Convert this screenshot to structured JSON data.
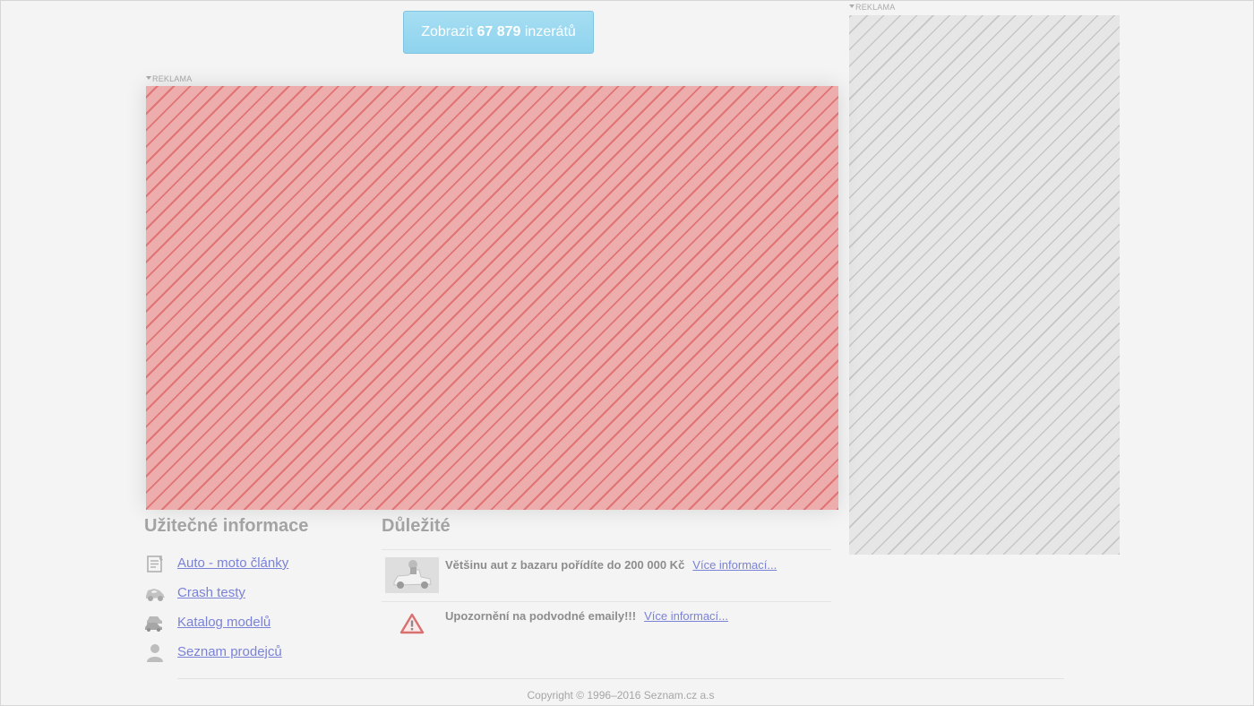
{
  "show_button": {
    "prefix": "Zobrazit",
    "count": "67 879",
    "suffix": "inzerátů"
  },
  "ads": {
    "main_label": "REKLAMA",
    "side_label": "REKLAMA"
  },
  "useful_info": {
    "heading": "Užitečné informace",
    "items": [
      {
        "label": "Auto - moto články",
        "icon": "article-icon"
      },
      {
        "label": "Crash testy",
        "icon": "crash-car-icon"
      },
      {
        "label": "Katalog modelů",
        "icon": "cars-catalog-icon"
      },
      {
        "label": "Seznam prodejců",
        "icon": "person-icon"
      }
    ]
  },
  "important": {
    "heading": "Důležité",
    "notices": [
      {
        "text": "Většinu aut z bazaru pořídíte do 200 000 Kč",
        "link": "Více informací...",
        "icon": "toy-car-thumbnail"
      },
      {
        "text": "Upozornění na podvodné emaily!!!",
        "link": "Více informací...",
        "icon": "warning-icon"
      }
    ]
  },
  "footer": {
    "copyright": "Copyright © 1996–2016 Seznam.cz a.s"
  },
  "colors": {
    "background": "#f4f4f4",
    "button": "#96d6ef",
    "link": "#7a82d6",
    "ad_main": "#eeadad",
    "ad_side": "#e6e6e6",
    "warning": "#d87070"
  }
}
